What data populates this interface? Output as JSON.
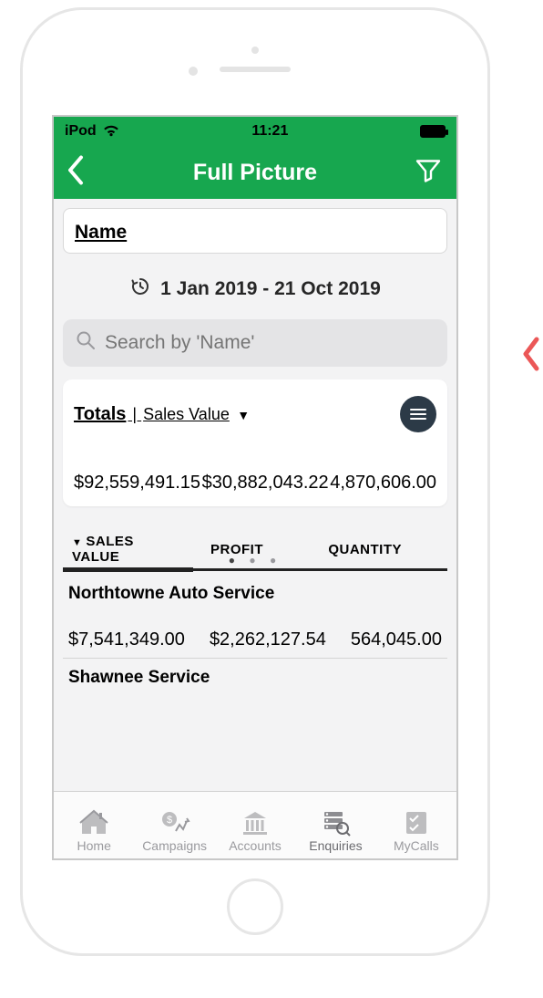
{
  "status": {
    "device": "iPod",
    "time": "11:21"
  },
  "nav": {
    "title": "Full Picture"
  },
  "name_field": {
    "label": "Name"
  },
  "date": {
    "range": "1 Jan 2019 - 21 Oct 2019"
  },
  "search": {
    "placeholder": "Search by 'Name'"
  },
  "totals": {
    "label": "Totals",
    "divider": " | ",
    "sort_by": "Sales Value",
    "values": {
      "sales_value": "$92,559,491.15",
      "profit": "$30,882,043.22",
      "quantity": "4,870,606.00"
    }
  },
  "columns": {
    "sales_value": "SALES VALUE",
    "profit": "PROFIT",
    "quantity": "QUANTITY"
  },
  "rows": [
    {
      "name": "Northtowne Auto Service",
      "sales_value": "$7,541,349.00",
      "profit": "$2,262,127.54",
      "quantity": "564,045.00"
    },
    {
      "name": "Shawnee Service",
      "sales_value": "",
      "profit": "",
      "quantity": ""
    }
  ],
  "tabs": {
    "home": "Home",
    "campaigns": "Campaigns",
    "accounts": "Accounts",
    "enquiries": "Enquiries",
    "mycalls": "MyCalls"
  }
}
